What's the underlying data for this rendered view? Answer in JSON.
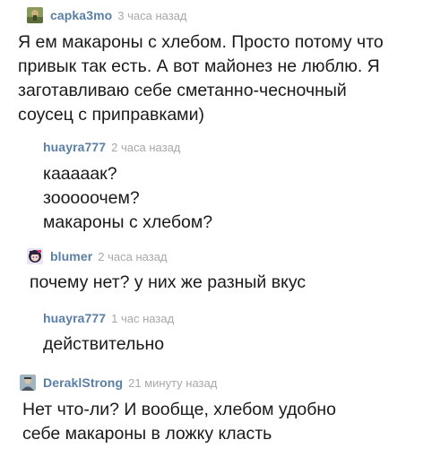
{
  "comments": [
    {
      "username": "сapka3mo",
      "avatar": "avatar-landscape-icon",
      "time": "3 часа назад",
      "lines": [
        "Я ем макароны с хлебом. Просто потому что",
        "привык так есть. А вот майонез не люблю. Я",
        "заготавливаю себе сметанно-чесночный",
        "соусец с приправками)"
      ]
    },
    {
      "username": "huayra777",
      "avatar": "",
      "time": "2 часа назад",
      "lines": [
        "кааааак?",
        "зооооочем?",
        "макароны с хлебом?"
      ]
    },
    {
      "username": "blumer",
      "avatar": "avatar-anime-girl-icon",
      "time": "2 часа назад",
      "lines": [
        "почему нет? у них же разный вкус"
      ]
    },
    {
      "username": "huayra777",
      "avatar": "",
      "time": "1 час назад",
      "lines": [
        "действительно"
      ]
    },
    {
      "username": "DeraklStrong",
      "avatar": "avatar-portrait-icon",
      "time": "21 минуту назад",
      "lines": [
        "Нет что-ли? И вообще, хлебом удобно",
        "себе макароны в ложку класть"
      ]
    }
  ],
  "colors": {
    "username": "#5a7fa6",
    "time": "#a8a8a8",
    "text": "#1a1a1a"
  }
}
